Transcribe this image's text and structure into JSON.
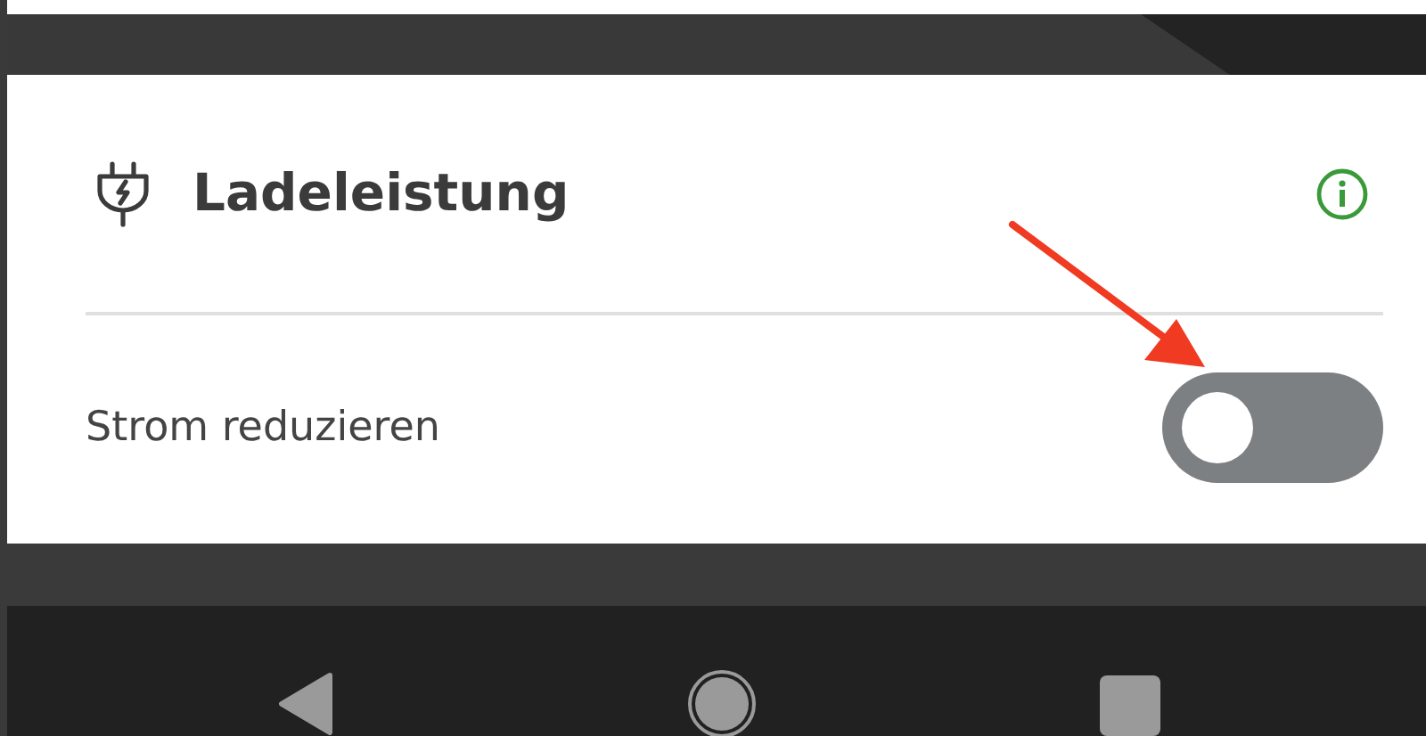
{
  "card": {
    "title": "Ladeleistung",
    "settings": [
      {
        "label": "Strom reduzieren",
        "on": false
      }
    ]
  }
}
